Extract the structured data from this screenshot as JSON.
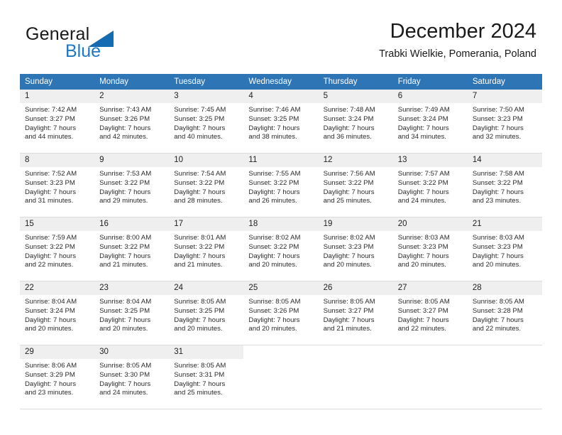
{
  "brand": {
    "word_one": "General",
    "word_two": "Blue",
    "triangle_icon": "triangle-icon",
    "accent_color": "#156bb1",
    "blue_text_color": "#1f78c1"
  },
  "header": {
    "title": "December 2024",
    "subtitle": "Trabki Wielkie, Pomerania, Poland"
  },
  "table": {
    "header_bg": "#2e75b6",
    "header_text_color": "#ffffff",
    "daynum_bg": "#efefef",
    "columns": [
      "Sunday",
      "Monday",
      "Tuesday",
      "Wednesday",
      "Thursday",
      "Friday",
      "Saturday"
    ]
  },
  "weeks": [
    [
      {
        "day": "1",
        "sunrise": "Sunrise: 7:42 AM",
        "sunset": "Sunset: 3:27 PM",
        "daylight_line1": "Daylight: 7 hours",
        "daylight_line2": "and 44 minutes."
      },
      {
        "day": "2",
        "sunrise": "Sunrise: 7:43 AM",
        "sunset": "Sunset: 3:26 PM",
        "daylight_line1": "Daylight: 7 hours",
        "daylight_line2": "and 42 minutes."
      },
      {
        "day": "3",
        "sunrise": "Sunrise: 7:45 AM",
        "sunset": "Sunset: 3:25 PM",
        "daylight_line1": "Daylight: 7 hours",
        "daylight_line2": "and 40 minutes."
      },
      {
        "day": "4",
        "sunrise": "Sunrise: 7:46 AM",
        "sunset": "Sunset: 3:25 PM",
        "daylight_line1": "Daylight: 7 hours",
        "daylight_line2": "and 38 minutes."
      },
      {
        "day": "5",
        "sunrise": "Sunrise: 7:48 AM",
        "sunset": "Sunset: 3:24 PM",
        "daylight_line1": "Daylight: 7 hours",
        "daylight_line2": "and 36 minutes."
      },
      {
        "day": "6",
        "sunrise": "Sunrise: 7:49 AM",
        "sunset": "Sunset: 3:24 PM",
        "daylight_line1": "Daylight: 7 hours",
        "daylight_line2": "and 34 minutes."
      },
      {
        "day": "7",
        "sunrise": "Sunrise: 7:50 AM",
        "sunset": "Sunset: 3:23 PM",
        "daylight_line1": "Daylight: 7 hours",
        "daylight_line2": "and 32 minutes."
      }
    ],
    [
      {
        "day": "8",
        "sunrise": "Sunrise: 7:52 AM",
        "sunset": "Sunset: 3:23 PM",
        "daylight_line1": "Daylight: 7 hours",
        "daylight_line2": "and 31 minutes."
      },
      {
        "day": "9",
        "sunrise": "Sunrise: 7:53 AM",
        "sunset": "Sunset: 3:22 PM",
        "daylight_line1": "Daylight: 7 hours",
        "daylight_line2": "and 29 minutes."
      },
      {
        "day": "10",
        "sunrise": "Sunrise: 7:54 AM",
        "sunset": "Sunset: 3:22 PM",
        "daylight_line1": "Daylight: 7 hours",
        "daylight_line2": "and 28 minutes."
      },
      {
        "day": "11",
        "sunrise": "Sunrise: 7:55 AM",
        "sunset": "Sunset: 3:22 PM",
        "daylight_line1": "Daylight: 7 hours",
        "daylight_line2": "and 26 minutes."
      },
      {
        "day": "12",
        "sunrise": "Sunrise: 7:56 AM",
        "sunset": "Sunset: 3:22 PM",
        "daylight_line1": "Daylight: 7 hours",
        "daylight_line2": "and 25 minutes."
      },
      {
        "day": "13",
        "sunrise": "Sunrise: 7:57 AM",
        "sunset": "Sunset: 3:22 PM",
        "daylight_line1": "Daylight: 7 hours",
        "daylight_line2": "and 24 minutes."
      },
      {
        "day": "14",
        "sunrise": "Sunrise: 7:58 AM",
        "sunset": "Sunset: 3:22 PM",
        "daylight_line1": "Daylight: 7 hours",
        "daylight_line2": "and 23 minutes."
      }
    ],
    [
      {
        "day": "15",
        "sunrise": "Sunrise: 7:59 AM",
        "sunset": "Sunset: 3:22 PM",
        "daylight_line1": "Daylight: 7 hours",
        "daylight_line2": "and 22 minutes."
      },
      {
        "day": "16",
        "sunrise": "Sunrise: 8:00 AM",
        "sunset": "Sunset: 3:22 PM",
        "daylight_line1": "Daylight: 7 hours",
        "daylight_line2": "and 21 minutes."
      },
      {
        "day": "17",
        "sunrise": "Sunrise: 8:01 AM",
        "sunset": "Sunset: 3:22 PM",
        "daylight_line1": "Daylight: 7 hours",
        "daylight_line2": "and 21 minutes."
      },
      {
        "day": "18",
        "sunrise": "Sunrise: 8:02 AM",
        "sunset": "Sunset: 3:22 PM",
        "daylight_line1": "Daylight: 7 hours",
        "daylight_line2": "and 20 minutes."
      },
      {
        "day": "19",
        "sunrise": "Sunrise: 8:02 AM",
        "sunset": "Sunset: 3:23 PM",
        "daylight_line1": "Daylight: 7 hours",
        "daylight_line2": "and 20 minutes."
      },
      {
        "day": "20",
        "sunrise": "Sunrise: 8:03 AM",
        "sunset": "Sunset: 3:23 PM",
        "daylight_line1": "Daylight: 7 hours",
        "daylight_line2": "and 20 minutes."
      },
      {
        "day": "21",
        "sunrise": "Sunrise: 8:03 AM",
        "sunset": "Sunset: 3:23 PM",
        "daylight_line1": "Daylight: 7 hours",
        "daylight_line2": "and 20 minutes."
      }
    ],
    [
      {
        "day": "22",
        "sunrise": "Sunrise: 8:04 AM",
        "sunset": "Sunset: 3:24 PM",
        "daylight_line1": "Daylight: 7 hours",
        "daylight_line2": "and 20 minutes."
      },
      {
        "day": "23",
        "sunrise": "Sunrise: 8:04 AM",
        "sunset": "Sunset: 3:25 PM",
        "daylight_line1": "Daylight: 7 hours",
        "daylight_line2": "and 20 minutes."
      },
      {
        "day": "24",
        "sunrise": "Sunrise: 8:05 AM",
        "sunset": "Sunset: 3:25 PM",
        "daylight_line1": "Daylight: 7 hours",
        "daylight_line2": "and 20 minutes."
      },
      {
        "day": "25",
        "sunrise": "Sunrise: 8:05 AM",
        "sunset": "Sunset: 3:26 PM",
        "daylight_line1": "Daylight: 7 hours",
        "daylight_line2": "and 20 minutes."
      },
      {
        "day": "26",
        "sunrise": "Sunrise: 8:05 AM",
        "sunset": "Sunset: 3:27 PM",
        "daylight_line1": "Daylight: 7 hours",
        "daylight_line2": "and 21 minutes."
      },
      {
        "day": "27",
        "sunrise": "Sunrise: 8:05 AM",
        "sunset": "Sunset: 3:27 PM",
        "daylight_line1": "Daylight: 7 hours",
        "daylight_line2": "and 22 minutes."
      },
      {
        "day": "28",
        "sunrise": "Sunrise: 8:05 AM",
        "sunset": "Sunset: 3:28 PM",
        "daylight_line1": "Daylight: 7 hours",
        "daylight_line2": "and 22 minutes."
      }
    ],
    [
      {
        "day": "29",
        "sunrise": "Sunrise: 8:06 AM",
        "sunset": "Sunset: 3:29 PM",
        "daylight_line1": "Daylight: 7 hours",
        "daylight_line2": "and 23 minutes."
      },
      {
        "day": "30",
        "sunrise": "Sunrise: 8:05 AM",
        "sunset": "Sunset: 3:30 PM",
        "daylight_line1": "Daylight: 7 hours",
        "daylight_line2": "and 24 minutes."
      },
      {
        "day": "31",
        "sunrise": "Sunrise: 8:05 AM",
        "sunset": "Sunset: 3:31 PM",
        "daylight_line1": "Daylight: 7 hours",
        "daylight_line2": "and 25 minutes."
      },
      {
        "day": "",
        "sunrise": "",
        "sunset": "",
        "daylight_line1": "",
        "daylight_line2": ""
      },
      {
        "day": "",
        "sunrise": "",
        "sunset": "",
        "daylight_line1": "",
        "daylight_line2": ""
      },
      {
        "day": "",
        "sunrise": "",
        "sunset": "",
        "daylight_line1": "",
        "daylight_line2": ""
      },
      {
        "day": "",
        "sunrise": "",
        "sunset": "",
        "daylight_line1": "",
        "daylight_line2": ""
      }
    ]
  ]
}
